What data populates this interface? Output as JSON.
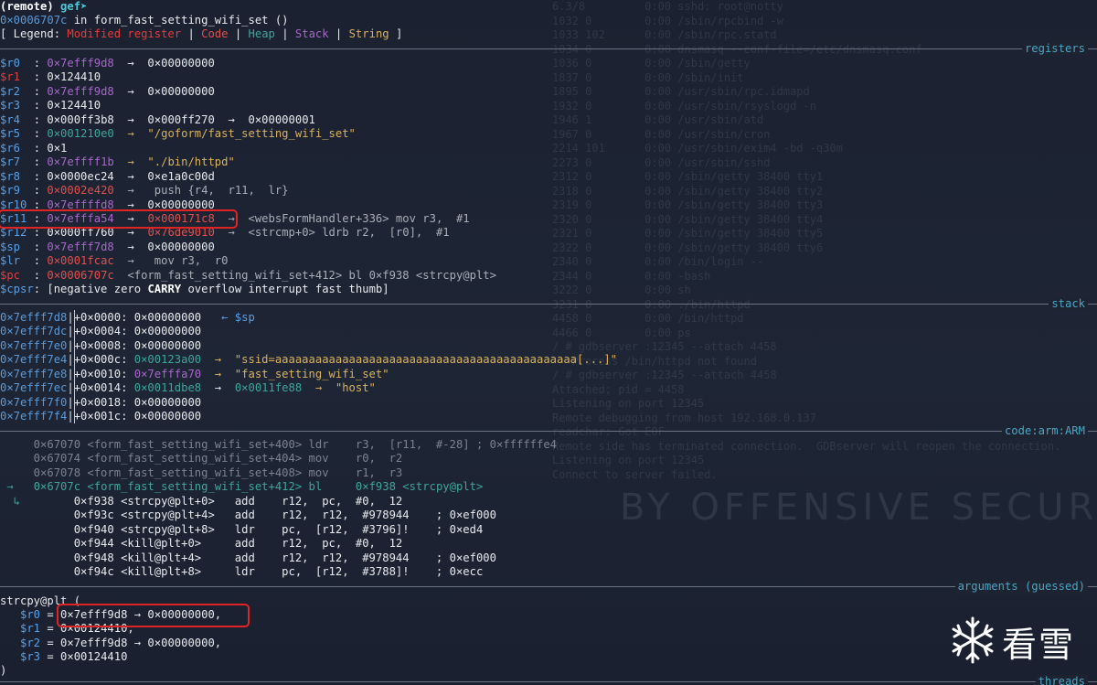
{
  "background": {
    "faint_lines": [
      "6.3/8         0:00 sshd: root@notty",
      "1032 0        0:00 /sbin/rpcbind -w",
      "1033 102      0:00 /sbin/rpc.statd",
      "1034 0        0:00 dnsmasq --conf-file=/etc/dnsmasq.conf",
      "1036 0        0:00 /sbin/getty",
      "1837 0        0:00 /sbin/init",
      "1895 0        0:00 /usr/sbin/rpc.idmapd",
      "1932 0        0:00 /usr/sbin/rsyslogd -n",
      "1946 1        0:00 /usr/sbin/atd",
      "1967 0        0:00 /usr/sbin/cron",
      "2214 101      0:00 /usr/sbin/exim4 -bd -q30m",
      "2273 0        0:00 /usr/sbin/sshd",
      "2312 0        0:00 /sbin/getty 38400 tty1",
      "2318 0        0:00 /sbin/getty 38400 tty2",
      "2319 0        0:00 /sbin/getty 38400 tty3",
      "2320 0        0:00 /sbin/getty 38400 tty4",
      "2321 0        0:00 /sbin/getty 38400 tty5",
      "2322 0        0:00 /sbin/getty 38400 tty6",
      "2340 0        0:00 /bin/login --",
      "2344 0        0:00 -bash",
      "3222 0        0:00 sh",
      "3231 0        0:00 ./bin/httpd",
      "4458 0        0:00 /bin/httpd",
      "4466 0        0:00 ps",
      "/ # gdbserver :12345 --attach 4458",
      "   Process /bin/httpd not found",
      "/ # gdbserver :12345 --attach 4458",
      "Attached; pid = 4458",
      "Listening on port 12345",
      "Remote debugging from host 192.168.0.137",
      "readchar: Got EOF",
      "Remote side has terminated connection.  GDBserver will reopen the connection.",
      "Listening on port 12345",
      "Connect to server failed."
    ],
    "watermark": "BY OFFENSIVE SECUR"
  },
  "header": {
    "prompt_remote": "(remote)",
    "prompt_gef": "gef➤",
    "location_addr": "0×0006707c",
    "location_in": " in ",
    "location_func": "form_fast_setting_wifi_set ()",
    "legend_open": "[ Legend: ",
    "legend_modified": "Modified register",
    "legend_sep": " | ",
    "legend_code": "Code",
    "legend_heap": "Heap",
    "legend_stack": "Stack",
    "legend_string": "String",
    "legend_close": " ]"
  },
  "sections": {
    "registers": "registers",
    "stack": "stack",
    "code": "code:arm:ARM",
    "arguments": "arguments (guessed)",
    "threads": "threads"
  },
  "registers": [
    {
      "name": "$r0 ",
      "modified": false,
      "value": "0×7efff9d8",
      "value_class": "stk",
      "chain": "  →  0×00000000"
    },
    {
      "name": "$r1 ",
      "modified": true,
      "value": "0×124410",
      "value_class": "white",
      "chain": ""
    },
    {
      "name": "$r2 ",
      "modified": false,
      "value": "0×7efff9d8",
      "value_class": "stk",
      "chain": "  →  0×00000000"
    },
    {
      "name": "$r3 ",
      "modified": false,
      "value": "0×124410",
      "value_class": "white",
      "chain": ""
    },
    {
      "name": "$r4 ",
      "modified": false,
      "value": "0×000ff3b8",
      "value_class": "white",
      "chain": "  →  0×000ff270  →  0×00000001"
    },
    {
      "name": "$r5 ",
      "modified": false,
      "value": "0×001210e0",
      "value_class": "heap",
      "chain": "  →  \"/goform/fast_setting_wifi_set\""
    },
    {
      "name": "$r6 ",
      "modified": false,
      "value": "0×1",
      "value_class": "white",
      "chain": ""
    },
    {
      "name": "$r7 ",
      "modified": false,
      "value": "0×7effff1b",
      "value_class": "stk",
      "chain": "  →  \"./bin/httpd\""
    },
    {
      "name": "$r8 ",
      "modified": false,
      "value": "0×0000ec24",
      "value_class": "white",
      "chain": "  →  0×e1a0c00d"
    },
    {
      "name": "$r9 ",
      "modified": false,
      "value": "0×0002e420",
      "value_class": "code",
      "chain": "  →   push {r4,  r11,  lr}"
    },
    {
      "name": "$r10",
      "modified": false,
      "value": "0×7effffd8",
      "value_class": "stk",
      "chain": "  →  0×00000000"
    },
    {
      "name": "$r11",
      "modified": false,
      "value": "0×7efffa54",
      "value_class": "stk",
      "chain_parts": [
        "  →  ",
        "0×000171c8",
        "  →  <websFormHandler+336> mov r3,  #1"
      ]
    },
    {
      "name": "$r12",
      "modified": false,
      "value": "0×000ff760",
      "value_class": "white",
      "chain_parts": [
        "  →  ",
        "0×76de9010",
        "  →  <strcmp+0> ldrb r2,  [r0],  #1"
      ]
    },
    {
      "name": "$sp ",
      "modified": false,
      "value": "0×7efff7d8",
      "value_class": "stk",
      "chain": "  →  0×00000000"
    },
    {
      "name": "$lr ",
      "modified": false,
      "value": "0×0001fcac",
      "value_class": "code",
      "chain": "  →   mov r3,  r0"
    },
    {
      "name": "$pc ",
      "modified": true,
      "value": "0×0006707c",
      "value_class": "code",
      "chain": "  <form_fast_setting_wifi_set+412> bl 0×f938 <strcpy@plt>"
    }
  ],
  "cpsr": {
    "name": "$cpsr",
    "pre": ": [negative zero ",
    "carry": "CARRY",
    "post": " overflow interrupt fast thumb]"
  },
  "stack": [
    {
      "addr": "0×7efff7d8",
      "off": "+0×0000: ",
      "val": "0×00000000",
      "val_class": "white",
      "rest": "   ← $sp",
      "rest_class": "reg"
    },
    {
      "addr": "0×7efff7dc",
      "off": "+0×0004: ",
      "val": "0×00000000",
      "val_class": "white",
      "rest": "",
      "rest_class": "white"
    },
    {
      "addr": "0×7efff7e0",
      "off": "+0×0008: ",
      "val": "0×00000000",
      "val_class": "white",
      "rest": "",
      "rest_class": "white"
    },
    {
      "addr": "0×7efff7e4",
      "off": "+0×000c: ",
      "val": "0×00123a00",
      "val_class": "heap",
      "rest": "  →  \"ssid=aaaaaaaaaaaaaaaaaaaaaaaaaaaaaaaaaaaaaaaaaaaaa[...]\"",
      "rest_class": "str"
    },
    {
      "addr": "0×7efff7e8",
      "off": "+0×0010: ",
      "val": "0×7efffa70",
      "val_class": "stk",
      "rest": "  →  \"fast_setting_wifi_set\"",
      "rest_class": "str"
    },
    {
      "addr": "0×7efff7ec",
      "off": "+0×0014: ",
      "val": "0×0011dbe8",
      "val_class": "heap",
      "rest_parts": [
        "  →  ",
        "0×0011fe88",
        "  →  \"host\""
      ]
    },
    {
      "addr": "0×7efff7f0",
      "off": "+0×0018: ",
      "val": "0×00000000",
      "val_class": "white",
      "rest": "",
      "rest_class": "white"
    },
    {
      "addr": "0×7efff7f4",
      "off": "+0×001c: ",
      "val": "0×00000000",
      "val_class": "white",
      "rest": "",
      "rest_class": "white"
    }
  ],
  "code": [
    {
      "marker": "",
      "text": "     0×67070 <form_fast_setting_wifi_set+400> ldr    r3,  [r11,  #-28] ; 0×ffffffe4",
      "cls": "dim"
    },
    {
      "marker": "",
      "text": "     0×67074 <form_fast_setting_wifi_set+404> mov    r0,  r2",
      "cls": "dim"
    },
    {
      "marker": "",
      "text": "     0×67078 <form_fast_setting_wifi_set+408> mov    r1,  r3",
      "cls": "dim"
    },
    {
      "marker": " →",
      "text": "   0×6707c <form_fast_setting_wifi_set+412> bl     0×f938 <strcpy@plt>",
      "cls": "heap"
    },
    {
      "marker": "  ↳",
      "text": "        0×f938 <strcpy@plt+0>   add    r12,  pc,  #0,  12",
      "cls": "white"
    },
    {
      "marker": "",
      "text": "           0×f93c <strcpy@plt+4>   add    r12,  r12,  #978944    ; 0×ef000",
      "cls": "white"
    },
    {
      "marker": "",
      "text": "           0×f940 <strcpy@plt+8>   ldr    pc,  [r12,  #3796]!    ; 0×ed4",
      "cls": "white"
    },
    {
      "marker": "",
      "text": "           0×f944 <kill@plt+0>     add    r12,  pc,  #0,  12",
      "cls": "white"
    },
    {
      "marker": "",
      "text": "           0×f948 <kill@plt+4>     add    r12,  r12,  #978944    ; 0×ef000",
      "cls": "white"
    },
    {
      "marker": "",
      "text": "           0×f94c <kill@plt+8>     ldr    pc,  [r12,  #3788]!    ; 0×ecc",
      "cls": "white"
    }
  ],
  "arguments": {
    "call": "strcpy@plt (",
    "args": [
      {
        "name": "$r0",
        "text": " = 0×7efff9d8 → 0×00000000,"
      },
      {
        "name": "$r1",
        "text": " = 0×00124410,"
      },
      {
        "name": "$r2",
        "text": " = 0×7efff9d8 → 0×00000000,"
      },
      {
        "name": "$r3",
        "text": " = 0×00124410"
      }
    ],
    "close": ")"
  },
  "logo": {
    "text": "看雪",
    "icon": "snowflake-icon",
    "color": "#ffffff"
  },
  "highlight_color": "#e02424"
}
